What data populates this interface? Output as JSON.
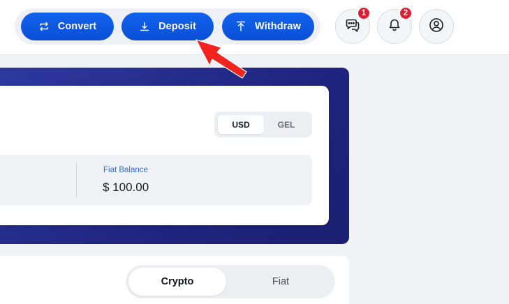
{
  "header": {
    "actions": {
      "convert": "Convert",
      "deposit": "Deposit",
      "withdraw": "Withdraw"
    },
    "chat_badge": "1",
    "notifications_badge": "2"
  },
  "balance": {
    "currencies": [
      "USD",
      "GEL"
    ],
    "selected_currency": "USD",
    "fiat_label": "Fiat Balance",
    "fiat_value": "$ 100.00"
  },
  "assets": {
    "tabs": [
      "Crypto",
      "Fiat"
    ],
    "selected_tab": "Crypto"
  },
  "icons": {
    "convert": "convert-arrows-icon",
    "deposit": "download-arrow-icon",
    "withdraw": "upload-arrow-icon",
    "chat": "chat-bubbles-icon",
    "bell": "bell-icon",
    "profile": "user-circle-icon",
    "annotation": "red-pointer-arrow"
  },
  "colors": {
    "primary_button": "#0a4fd6",
    "banner": "#1f2580",
    "badge": "#dc1f33",
    "annotation_arrow": "#f1231f",
    "fiat_label": "#2f6bd8"
  }
}
